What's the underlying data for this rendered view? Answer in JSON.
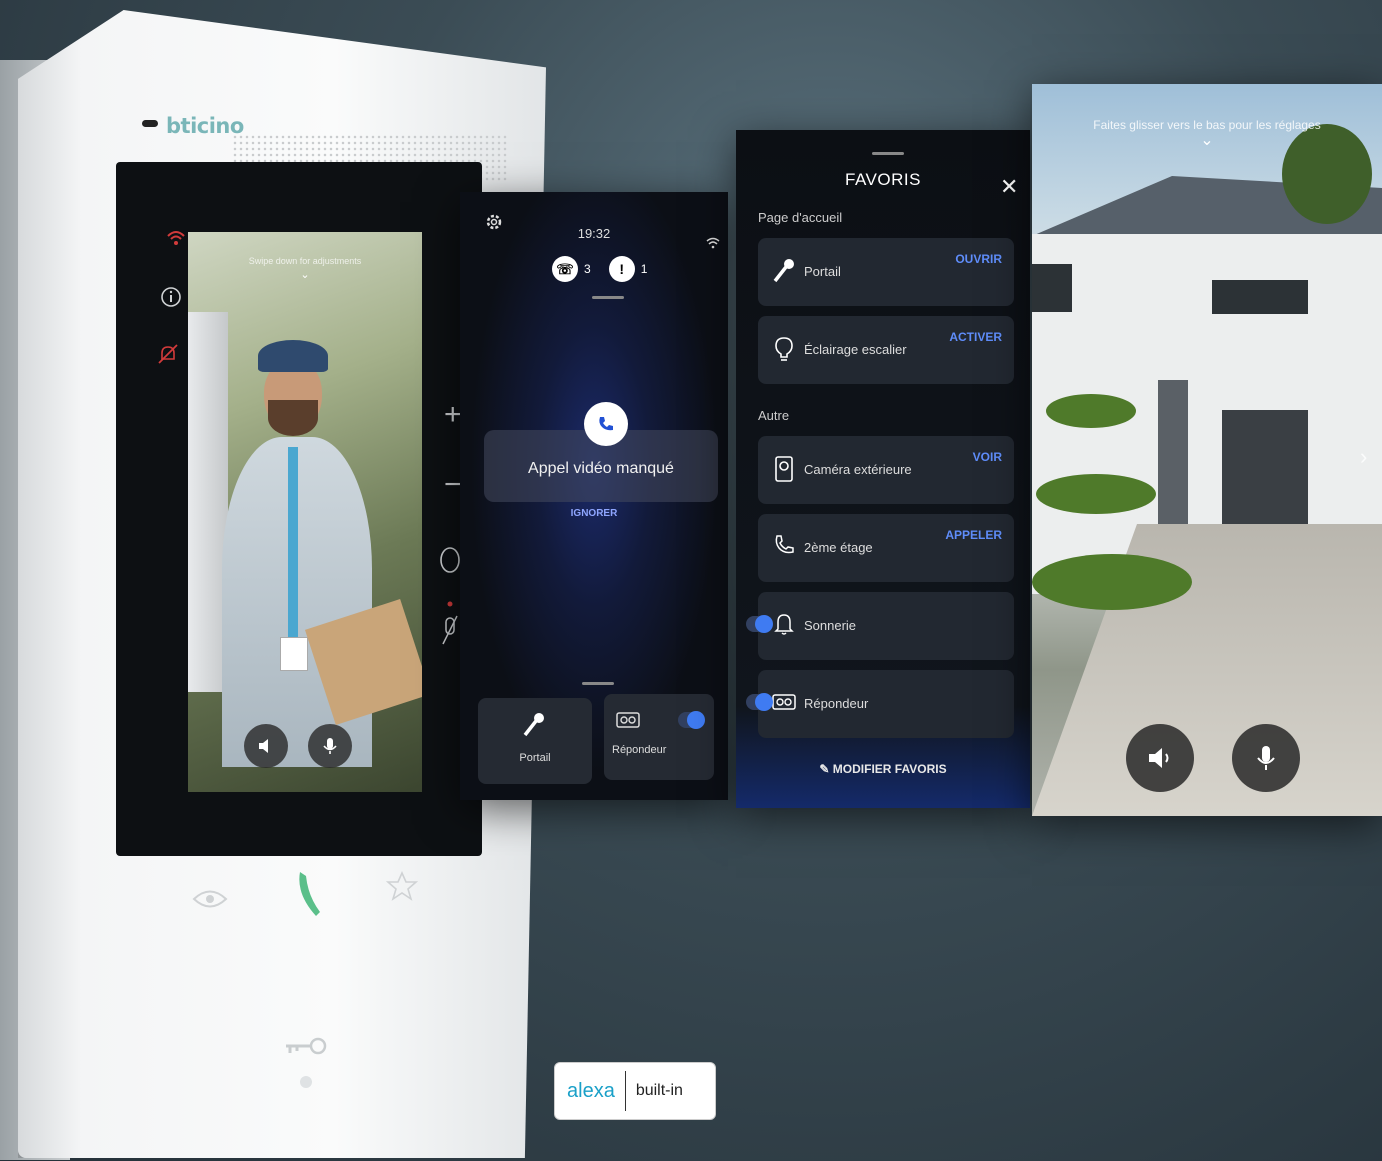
{
  "device": {
    "brand": "bticino",
    "screen_hint": "Swipe down for adjustments",
    "chevron": "⌄",
    "icons": [
      "wifi-icon",
      "info-icon",
      "bell-muted-icon",
      "plus-icon",
      "minus-icon",
      "circle-icon",
      "mic-muted-icon",
      "eye-icon",
      "handset-icon",
      "star-icon",
      "key-icon"
    ]
  },
  "missed_call": {
    "time": "19:32",
    "calls_count": "3",
    "alerts_count": "1",
    "title": "Appel vidéo manqué",
    "ignore": "IGNORER",
    "tiles": [
      {
        "label": "Portail"
      },
      {
        "label": "Répondeur"
      }
    ]
  },
  "favoris": {
    "title": "FAVORIS",
    "close": "✕",
    "section_home": "Page d'accueil",
    "section_other": "Autre",
    "rows": [
      {
        "label": "Portail",
        "action": "OUVRIR"
      },
      {
        "label": "Éclairage escalier",
        "action": "ACTIVER"
      },
      {
        "label": "Caméra extérieure",
        "action": "VOIR"
      },
      {
        "label": "2ème étage",
        "action": "APPELER"
      },
      {
        "label": "Sonnerie",
        "action": ""
      },
      {
        "label": "Répondeur",
        "action": ""
      }
    ],
    "edit": "MODIFIER FAVORIS"
  },
  "camera": {
    "hint": "Faites glisser vers le bas pour les réglages",
    "chevron": "⌄"
  },
  "alexa": {
    "logo": "alexa",
    "text": "built-in"
  },
  "colors": {
    "accent_blue": "#3f7bf2",
    "action_blue": "#5f8dfa",
    "brand_teal": "#7ab6b8"
  }
}
